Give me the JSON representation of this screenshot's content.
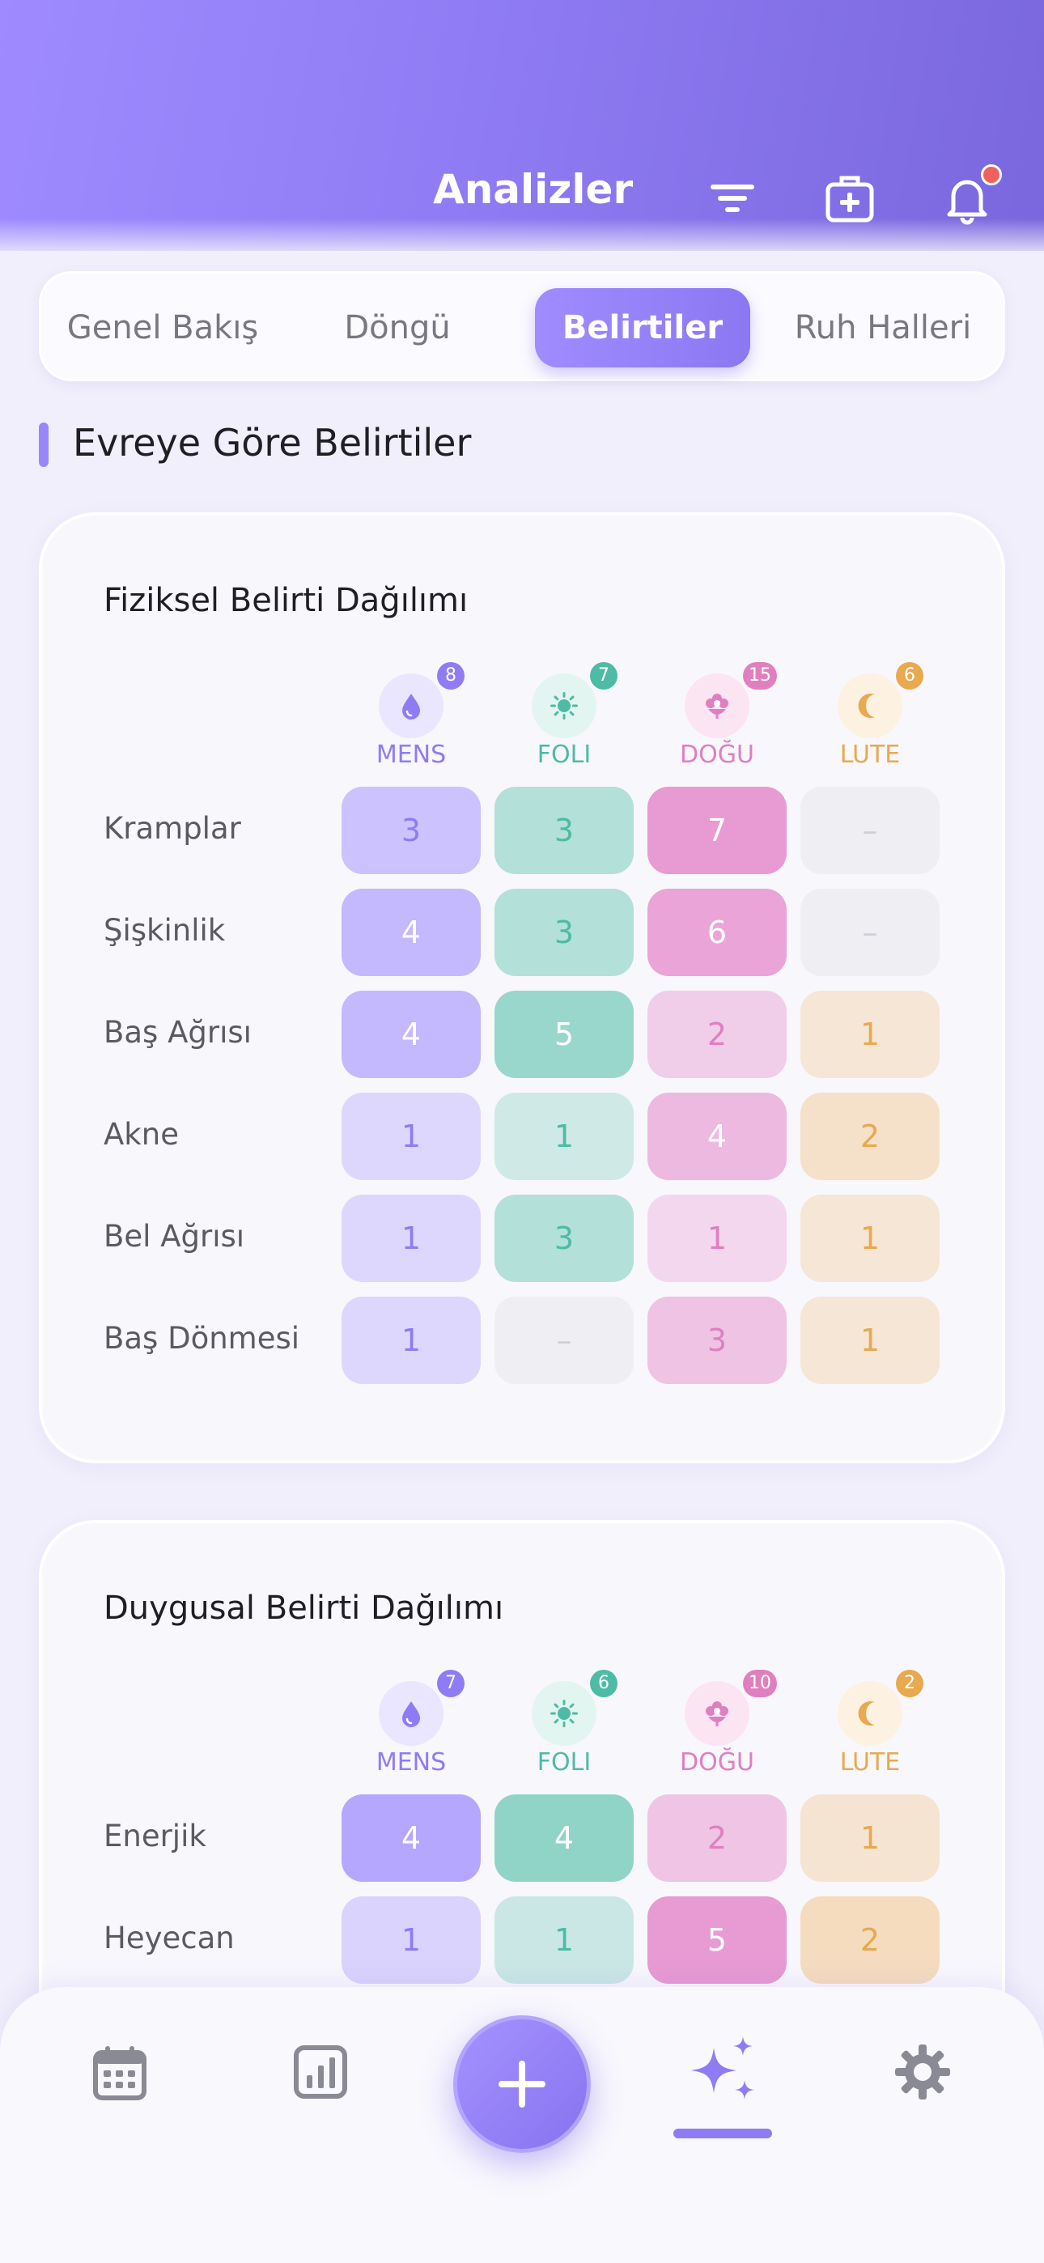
{
  "header": {
    "title": "Analizler"
  },
  "tabs": [
    {
      "label": "Genel Bakış",
      "active": false
    },
    {
      "label": "Döngü",
      "active": false
    },
    {
      "label": "Belirtiler",
      "active": true
    },
    {
      "label": "Ruh Halleri",
      "active": false
    }
  ],
  "section": {
    "title": "Evreye Göre Belirtiler"
  },
  "phases": [
    {
      "code": "MENS",
      "icon": "drop-icon",
      "color": "#8f7cf4"
    },
    {
      "code": "FOLI",
      "icon": "sun-icon",
      "color": "#4dbba5"
    },
    {
      "code": "DOĞU",
      "icon": "flower-icon",
      "color": "#e07fc0"
    },
    {
      "code": "LUTE",
      "icon": "moon-icon",
      "color": "#e8a94f"
    }
  ],
  "physical": {
    "title": "Fiziksel Belirti Dağılımı",
    "counts": [
      "8",
      "7",
      "15",
      "6"
    ],
    "rows": [
      {
        "label": "Kramplar",
        "values": [
          "3",
          "3",
          "7",
          "–"
        ]
      },
      {
        "label": "Şişkinlik",
        "values": [
          "4",
          "3",
          "6",
          "–"
        ]
      },
      {
        "label": "Baş Ağrısı",
        "values": [
          "4",
          "5",
          "2",
          "1"
        ]
      },
      {
        "label": "Akne",
        "values": [
          "1",
          "1",
          "4",
          "2"
        ]
      },
      {
        "label": "Bel Ağrısı",
        "values": [
          "1",
          "3",
          "1",
          "1"
        ]
      },
      {
        "label": "Baş Dönmesi",
        "values": [
          "1",
          "–",
          "3",
          "1"
        ]
      }
    ]
  },
  "emotional": {
    "title": "Duygusal Belirti Dağılımı",
    "counts": [
      "7",
      "6",
      "10",
      "2"
    ],
    "rows": [
      {
        "label": "Enerjik",
        "values": [
          "4",
          "4",
          "2",
          "1"
        ]
      },
      {
        "label": "Heyecan",
        "values": [
          "1",
          "1",
          "5",
          "2"
        ]
      }
    ]
  },
  "nav": {
    "items": [
      "calendar-icon",
      "chart-icon",
      "add-icon",
      "sparkles-icon",
      "gear-icon"
    ],
    "active": "sparkles-icon"
  }
}
